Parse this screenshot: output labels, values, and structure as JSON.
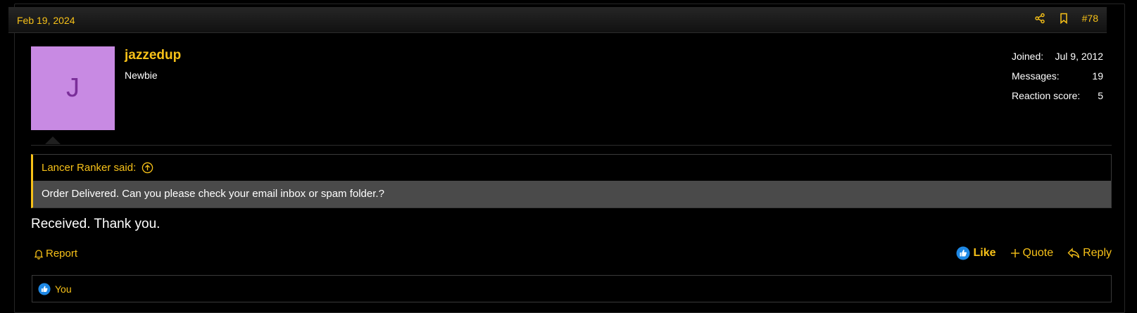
{
  "post": {
    "date": "Feb 19, 2024",
    "number": "#78"
  },
  "user": {
    "avatar_letter": "J",
    "avatar_color": "#c88ae3",
    "name": "jazzedup",
    "title": "Newbie",
    "stats": [
      {
        "label": "Joined:",
        "value": "Jul 9, 2012"
      },
      {
        "label": "Messages:",
        "value": "19"
      },
      {
        "label": "Reaction score:",
        "value": "5"
      }
    ]
  },
  "quote": {
    "author_label": "Lancer Ranker said:",
    "text": "Order Delivered. Can you please check your email inbox or spam folder.?"
  },
  "message": {
    "text": "Received. Thank you."
  },
  "actions": {
    "report": "Report",
    "like": "Like",
    "quote": "Quote",
    "reply": "Reply"
  },
  "reactions": {
    "label": "You"
  },
  "colors": {
    "accent": "#f7c118",
    "like_blue": "#1e88e5",
    "quote_bg": "#4a4a4a"
  },
  "icons": [
    "share-icon",
    "bookmark-icon",
    "jump-to-quote-icon",
    "bell-icon",
    "thumbs-up-icon",
    "plus-icon",
    "reply-icon"
  ]
}
